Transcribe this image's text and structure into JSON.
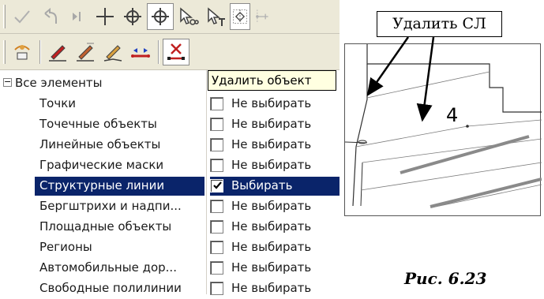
{
  "tooltip": "Удалить объект",
  "tree": {
    "root_label": "Все элементы",
    "root_expander": "−",
    "rows": [
      {
        "name": "Точки",
        "value": "Не выбирать",
        "checked": false
      },
      {
        "name": "Точечные объекты",
        "value": "Не выбирать",
        "checked": false
      },
      {
        "name": "Линейные объекты",
        "value": "Не выбирать",
        "checked": false
      },
      {
        "name": "Графические маски",
        "value": "Не выбирать",
        "checked": false
      },
      {
        "name": "Структурные линии",
        "value": "Выбирать",
        "checked": true
      },
      {
        "name": "Бергштрихи и надпи...",
        "value": "Не выбирать",
        "checked": false
      },
      {
        "name": "Площадные объекты",
        "value": "Не выбирать",
        "checked": false
      },
      {
        "name": "Регионы",
        "value": "Не выбирать",
        "checked": false
      },
      {
        "name": "Автомобильные дор...",
        "value": "Не выбирать",
        "checked": false
      },
      {
        "name": "Свободные полилинии",
        "value": "Не выбирать",
        "checked": false
      }
    ]
  },
  "figure": {
    "callout": "Удалить СЛ",
    "number_label": "4",
    "caption": "Рис. 6.23"
  },
  "colors": {
    "selection": "#0a246a",
    "toolbar": "#ece9d8",
    "tooltip_bg": "#ffffe1"
  }
}
